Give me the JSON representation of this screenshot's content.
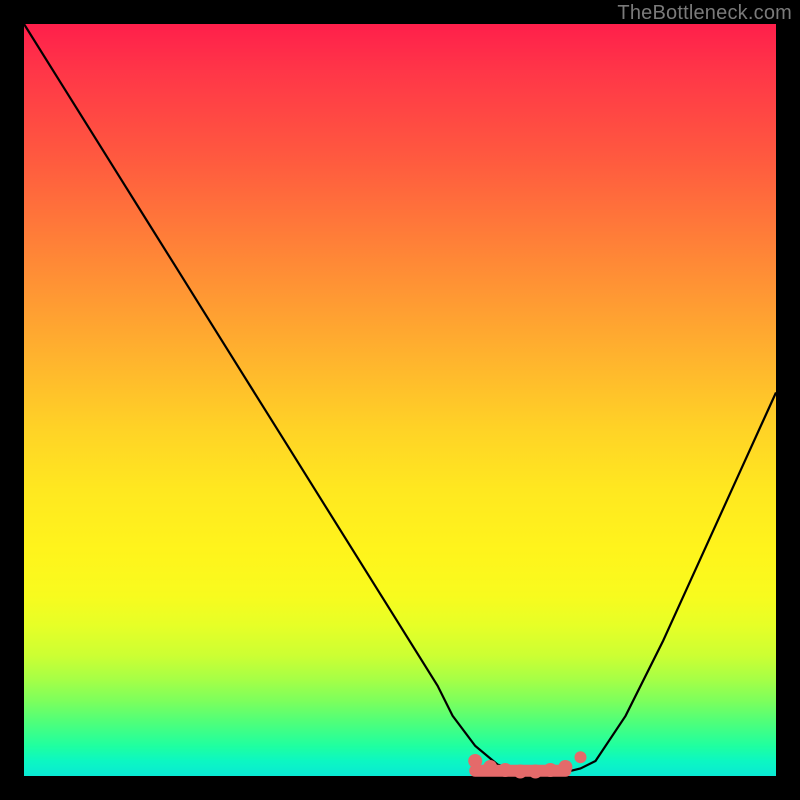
{
  "watermark": "TheBottleneck.com",
  "colors": {
    "frame_bg": "#000000",
    "curve_stroke": "#000000",
    "marker_fill": "#e46a6a",
    "marker_stroke": "#d95a5a"
  },
  "chart_data": {
    "type": "line",
    "title": "",
    "xlabel": "",
    "ylabel": "",
    "xlim": [
      0,
      100
    ],
    "ylim": [
      0,
      100
    ],
    "x": [
      0,
      5,
      10,
      15,
      20,
      25,
      30,
      35,
      40,
      45,
      50,
      55,
      57,
      60,
      63,
      66,
      69,
      72,
      74,
      76,
      80,
      85,
      90,
      95,
      100
    ],
    "values": [
      100,
      92,
      84,
      76,
      68,
      60,
      52,
      44,
      36,
      28,
      20,
      12,
      8,
      4,
      1.5,
      0.5,
      0.5,
      0.5,
      1,
      2,
      8,
      18,
      29,
      40,
      51
    ],
    "markers": {
      "x": [
        60,
        62,
        64,
        66,
        68,
        70,
        72,
        74
      ],
      "y": [
        2.0,
        1.2,
        0.8,
        0.6,
        0.6,
        0.8,
        1.2,
        2.5
      ]
    }
  }
}
